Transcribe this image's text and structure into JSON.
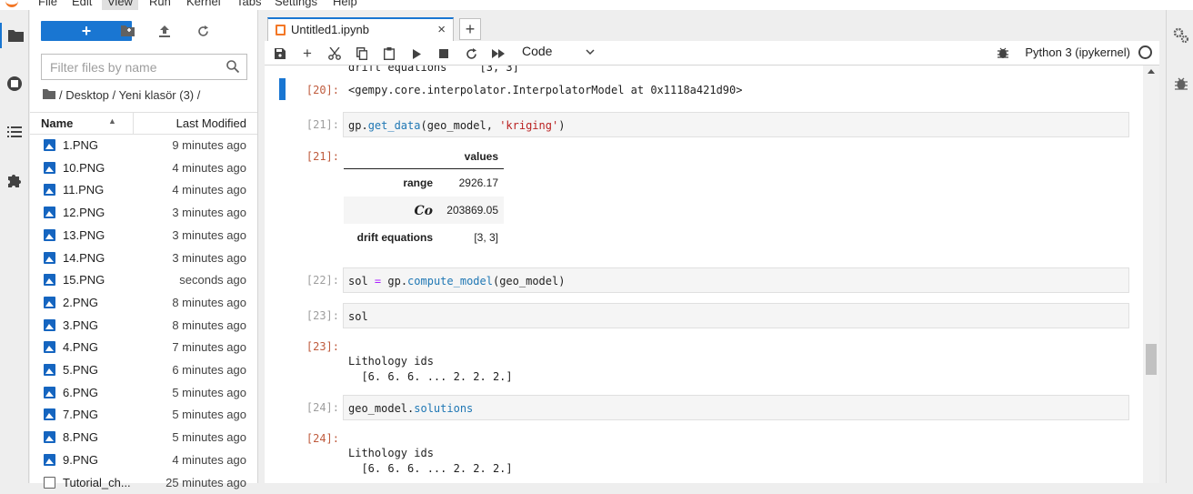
{
  "menu": {
    "items": [
      "File",
      "Edit",
      "View",
      "Run",
      "Kernel",
      "Tabs",
      "Settings",
      "Help"
    ],
    "active": "View"
  },
  "filebrowser": {
    "new_label": "+",
    "filter_placeholder": "Filter files by name",
    "breadcrumb": "/ Desktop / Yeni klasör (3) /",
    "col_name": "Name",
    "col_modified": "Last Modified",
    "files": [
      {
        "name": "1.PNG",
        "modified": "9 minutes ago"
      },
      {
        "name": "10.PNG",
        "modified": "4 minutes ago"
      },
      {
        "name": "11.PNG",
        "modified": "4 minutes ago"
      },
      {
        "name": "12.PNG",
        "modified": "3 minutes ago"
      },
      {
        "name": "13.PNG",
        "modified": "3 minutes ago"
      },
      {
        "name": "14.PNG",
        "modified": "3 minutes ago"
      },
      {
        "name": "15.PNG",
        "modified": "seconds ago"
      },
      {
        "name": "2.PNG",
        "modified": "8 minutes ago"
      },
      {
        "name": "3.PNG",
        "modified": "8 minutes ago"
      },
      {
        "name": "4.PNG",
        "modified": "7 minutes ago"
      },
      {
        "name": "5.PNG",
        "modified": "6 minutes ago"
      },
      {
        "name": "6.PNG",
        "modified": "5 minutes ago"
      },
      {
        "name": "7.PNG",
        "modified": "5 minutes ago"
      },
      {
        "name": "8.PNG",
        "modified": "5 minutes ago"
      },
      {
        "name": "9.PNG",
        "modified": "4 minutes ago"
      },
      {
        "name": "Tutorial_ch...",
        "modified": "25 minutes ago"
      }
    ]
  },
  "tab": {
    "title": "Untitled1.ipynb",
    "close": "×",
    "add": "+"
  },
  "toolbar": {
    "cell_type": "Code",
    "kernel": "Python 3 (ipykernel)"
  },
  "notebook": {
    "top_partial_text": "drift equations     [3, 3]",
    "out20_prompt": "[20]:",
    "out20_text": "<gempy.core.interpolator.InterpolatorModel at 0x1118a421d90>",
    "in21_prompt": "[21]:",
    "in21_code": {
      "pre": "gp.",
      "fn": "get_data",
      "mid": "(geo_model, ",
      "str": "'kriging'",
      "post": ")"
    },
    "out21_prompt": "[21]:",
    "df": {
      "header": "values",
      "rows": [
        {
          "label": "range",
          "value": "2926.17"
        },
        {
          "label": "Co",
          "value": "203869.05"
        },
        {
          "label": "drift equations",
          "value": "[3, 3]"
        }
      ]
    },
    "in22_prompt": "[22]:",
    "in22_code": {
      "a": "sol ",
      "eq": "=",
      "b": " gp.",
      "fn": "compute_model",
      "c": "(geo_model)"
    },
    "in23_prompt": "[23]:",
    "in23_code": "sol",
    "out23_prompt": "[23]:",
    "out23_line1": "Lithology ids",
    "out23_line2": "  [6. 6. 6. ... 2. 2. 2.]",
    "in24_prompt": "[24]:",
    "in24_code": {
      "pre": "geo_model.",
      "attr": "solutions"
    },
    "out24_prompt": "[24]:",
    "out24_line1": "Lithology ids",
    "out24_line2": "  [6. 6. 6. ... 2. 2. 2.]"
  }
}
